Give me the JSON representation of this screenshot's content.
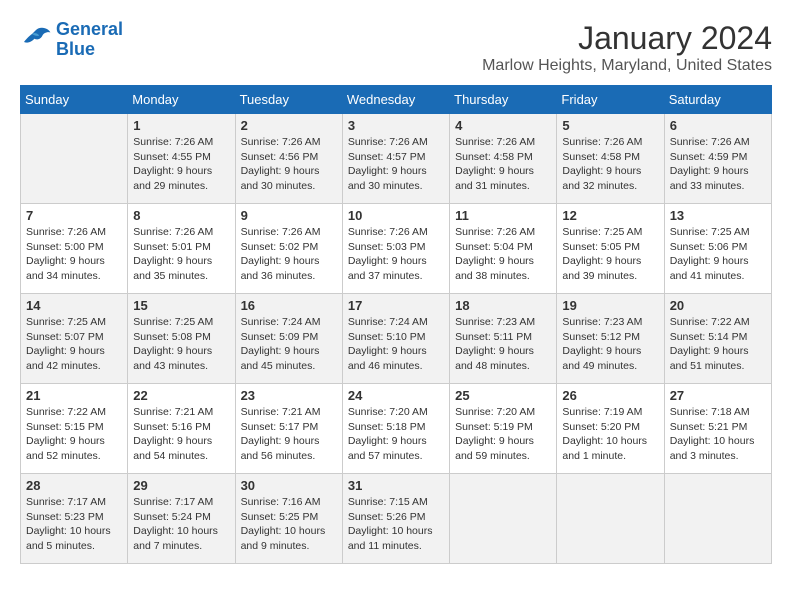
{
  "logo": {
    "text_general": "General",
    "text_blue": "Blue"
  },
  "title": "January 2024",
  "subtitle": "Marlow Heights, Maryland, United States",
  "weekdays": [
    "Sunday",
    "Monday",
    "Tuesday",
    "Wednesday",
    "Thursday",
    "Friday",
    "Saturday"
  ],
  "weeks": [
    [
      {
        "day": "",
        "info": ""
      },
      {
        "day": "1",
        "info": "Sunrise: 7:26 AM\nSunset: 4:55 PM\nDaylight: 9 hours\nand 29 minutes."
      },
      {
        "day": "2",
        "info": "Sunrise: 7:26 AM\nSunset: 4:56 PM\nDaylight: 9 hours\nand 30 minutes."
      },
      {
        "day": "3",
        "info": "Sunrise: 7:26 AM\nSunset: 4:57 PM\nDaylight: 9 hours\nand 30 minutes."
      },
      {
        "day": "4",
        "info": "Sunrise: 7:26 AM\nSunset: 4:58 PM\nDaylight: 9 hours\nand 31 minutes."
      },
      {
        "day": "5",
        "info": "Sunrise: 7:26 AM\nSunset: 4:58 PM\nDaylight: 9 hours\nand 32 minutes."
      },
      {
        "day": "6",
        "info": "Sunrise: 7:26 AM\nSunset: 4:59 PM\nDaylight: 9 hours\nand 33 minutes."
      }
    ],
    [
      {
        "day": "7",
        "info": "Sunrise: 7:26 AM\nSunset: 5:00 PM\nDaylight: 9 hours\nand 34 minutes."
      },
      {
        "day": "8",
        "info": "Sunrise: 7:26 AM\nSunset: 5:01 PM\nDaylight: 9 hours\nand 35 minutes."
      },
      {
        "day": "9",
        "info": "Sunrise: 7:26 AM\nSunset: 5:02 PM\nDaylight: 9 hours\nand 36 minutes."
      },
      {
        "day": "10",
        "info": "Sunrise: 7:26 AM\nSunset: 5:03 PM\nDaylight: 9 hours\nand 37 minutes."
      },
      {
        "day": "11",
        "info": "Sunrise: 7:26 AM\nSunset: 5:04 PM\nDaylight: 9 hours\nand 38 minutes."
      },
      {
        "day": "12",
        "info": "Sunrise: 7:25 AM\nSunset: 5:05 PM\nDaylight: 9 hours\nand 39 minutes."
      },
      {
        "day": "13",
        "info": "Sunrise: 7:25 AM\nSunset: 5:06 PM\nDaylight: 9 hours\nand 41 minutes."
      }
    ],
    [
      {
        "day": "14",
        "info": "Sunrise: 7:25 AM\nSunset: 5:07 PM\nDaylight: 9 hours\nand 42 minutes."
      },
      {
        "day": "15",
        "info": "Sunrise: 7:25 AM\nSunset: 5:08 PM\nDaylight: 9 hours\nand 43 minutes."
      },
      {
        "day": "16",
        "info": "Sunrise: 7:24 AM\nSunset: 5:09 PM\nDaylight: 9 hours\nand 45 minutes."
      },
      {
        "day": "17",
        "info": "Sunrise: 7:24 AM\nSunset: 5:10 PM\nDaylight: 9 hours\nand 46 minutes."
      },
      {
        "day": "18",
        "info": "Sunrise: 7:23 AM\nSunset: 5:11 PM\nDaylight: 9 hours\nand 48 minutes."
      },
      {
        "day": "19",
        "info": "Sunrise: 7:23 AM\nSunset: 5:12 PM\nDaylight: 9 hours\nand 49 minutes."
      },
      {
        "day": "20",
        "info": "Sunrise: 7:22 AM\nSunset: 5:14 PM\nDaylight: 9 hours\nand 51 minutes."
      }
    ],
    [
      {
        "day": "21",
        "info": "Sunrise: 7:22 AM\nSunset: 5:15 PM\nDaylight: 9 hours\nand 52 minutes."
      },
      {
        "day": "22",
        "info": "Sunrise: 7:21 AM\nSunset: 5:16 PM\nDaylight: 9 hours\nand 54 minutes."
      },
      {
        "day": "23",
        "info": "Sunrise: 7:21 AM\nSunset: 5:17 PM\nDaylight: 9 hours\nand 56 minutes."
      },
      {
        "day": "24",
        "info": "Sunrise: 7:20 AM\nSunset: 5:18 PM\nDaylight: 9 hours\nand 57 minutes."
      },
      {
        "day": "25",
        "info": "Sunrise: 7:20 AM\nSunset: 5:19 PM\nDaylight: 9 hours\nand 59 minutes."
      },
      {
        "day": "26",
        "info": "Sunrise: 7:19 AM\nSunset: 5:20 PM\nDaylight: 10 hours\nand 1 minute."
      },
      {
        "day": "27",
        "info": "Sunrise: 7:18 AM\nSunset: 5:21 PM\nDaylight: 10 hours\nand 3 minutes."
      }
    ],
    [
      {
        "day": "28",
        "info": "Sunrise: 7:17 AM\nSunset: 5:23 PM\nDaylight: 10 hours\nand 5 minutes."
      },
      {
        "day": "29",
        "info": "Sunrise: 7:17 AM\nSunset: 5:24 PM\nDaylight: 10 hours\nand 7 minutes."
      },
      {
        "day": "30",
        "info": "Sunrise: 7:16 AM\nSunset: 5:25 PM\nDaylight: 10 hours\nand 9 minutes."
      },
      {
        "day": "31",
        "info": "Sunrise: 7:15 AM\nSunset: 5:26 PM\nDaylight: 10 hours\nand 11 minutes."
      },
      {
        "day": "",
        "info": ""
      },
      {
        "day": "",
        "info": ""
      },
      {
        "day": "",
        "info": ""
      }
    ]
  ]
}
